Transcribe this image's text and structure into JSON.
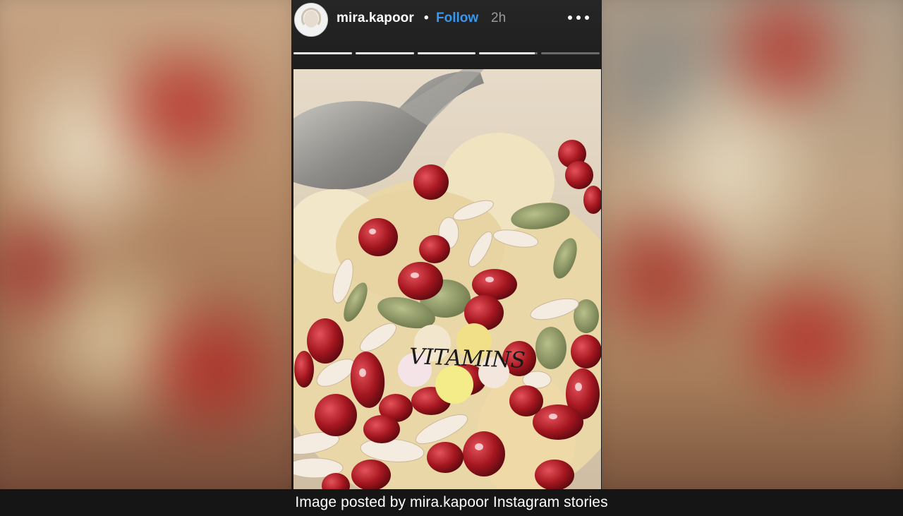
{
  "story": {
    "username": "mira.kapoor",
    "separator": "•",
    "follow_label": "Follow",
    "age": "2h",
    "progress": [
      1,
      1,
      1,
      0.95,
      0
    ],
    "sticker_text": "VITAMINS",
    "icons": {
      "avatar": "profile-avatar",
      "more": "more-options-icon"
    }
  },
  "caption": "Image posted by mira.kapoor Instagram stories",
  "colors": {
    "follow": "#3897f0",
    "header_bg": "#262626",
    "caption_bg": "#151515"
  }
}
